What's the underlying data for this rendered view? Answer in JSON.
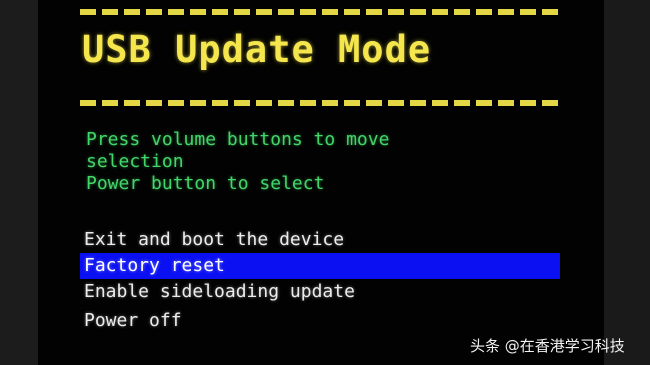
{
  "screen": {
    "title": "USB Update Mode",
    "instructions": [
      "Press volume buttons to move",
      "selection",
      "Power button to select"
    ],
    "menu": [
      {
        "label": "Exit and boot the device",
        "selected": false
      },
      {
        "label": "Factory reset",
        "selected": true
      },
      {
        "label": "Enable sideloading update",
        "selected": false
      },
      {
        "label": "Power off",
        "selected": false
      }
    ]
  },
  "watermark": "头条 @在香港学习科技",
  "colors": {
    "title": "#f4e64c",
    "instructions": "#43d56a",
    "menu_text": "#ececec",
    "selection_bar": "#0a10f2"
  }
}
